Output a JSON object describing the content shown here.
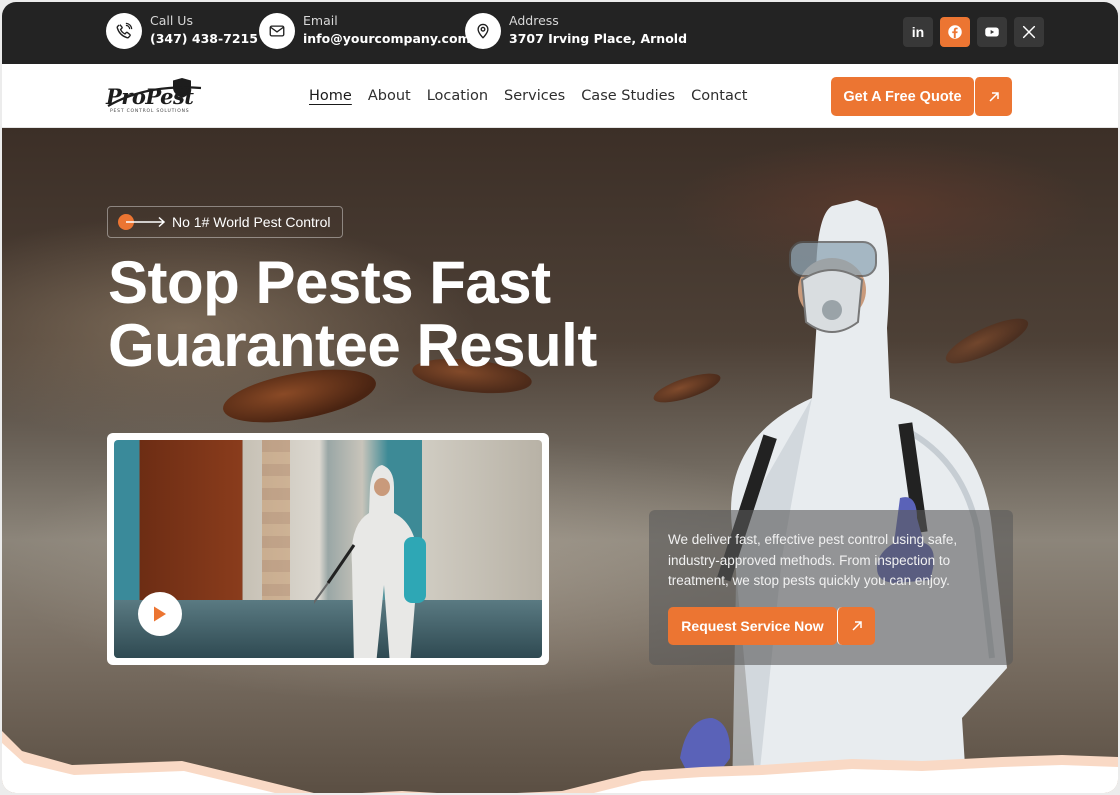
{
  "topbar": {
    "call": {
      "label": "Call Us",
      "value": "(347) 438-7215",
      "icon": "phone-icon"
    },
    "email": {
      "label": "Email",
      "value": "info@yourcompany.com",
      "icon": "mail-icon"
    },
    "address": {
      "label": "Address",
      "value": "3707 Irving Place, Arnold",
      "icon": "map-pin-icon"
    },
    "socials": [
      {
        "name": "linkedin",
        "glyph": "in",
        "active": false
      },
      {
        "name": "facebook",
        "glyph": "f",
        "active": true
      },
      {
        "name": "youtube",
        "glyph": "yt",
        "active": false
      },
      {
        "name": "x",
        "glyph": "X",
        "active": false
      }
    ]
  },
  "nav": {
    "logo_text": "ProPest",
    "logo_subtitle": "PEST CONTROL SOLUTIONS",
    "items": [
      "Home",
      "About",
      "Location",
      "Services",
      "Case Studies",
      "Contact"
    ],
    "active_item": "Home",
    "cta_label": "Get A Free Quote"
  },
  "hero": {
    "badge": "No 1# World Pest Control",
    "title_line1": "Stop Pests Fast",
    "title_line2": "Guarantee Result",
    "description": "We deliver fast, effective pest control using safe, industry-approved methods. From inspection to treatment, we stop pests quickly you can enjoy.",
    "cta_label": "Request Service Now"
  },
  "colors": {
    "accent": "#ec7532",
    "topbar_bg": "#232323",
    "wave": "#f9d9c5"
  }
}
